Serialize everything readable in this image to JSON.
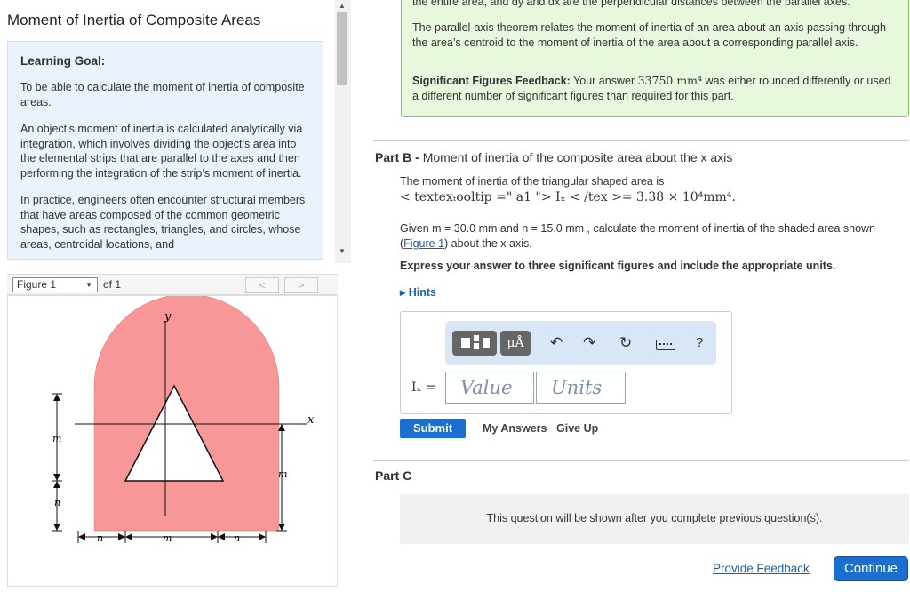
{
  "left": {
    "title": "Moment of Inertia of Composite Areas",
    "goal_heading": "Learning Goal:",
    "goal_p1": "To be able to calculate the moment of inertia of composite areas.",
    "goal_p2": "An object’s moment of inertia is calculated analytically via integration, which involves dividing the object’s area into the elemental strips that are parallel to the axes and then performing the integration of the strip’s moment of inertia.",
    "goal_p3": "In practice, engineers often encounter structural members that have areas composed of the common geometric shapes, such as rectangles, triangles, and circles, whose areas, centroidal locations, and"
  },
  "figure": {
    "select_value": "Figure 1",
    "of_label": "of 1",
    "prev_label": "<",
    "next_label": ">",
    "labels": {
      "y": "y",
      "x": "x",
      "m_left": "m",
      "n_left": "n",
      "m_right": "m",
      "n_bottom1": "n",
      "m_bottom": "m",
      "n_bottom2": "n"
    },
    "shape_color": "#f79797"
  },
  "feedback": {
    "cut_text": "the entire area, and dy and dx are the perpendicular distances between the parallel axes.",
    "theorem": "The parallel-axis theorem relates the moment of inertia of an area about an axis passing through the area’s centroid to the moment of inertia of the area about a corresponding parallel axis.",
    "sigfig_label": "Significant Figures Feedback:",
    "sigfig_pre": "Your answer",
    "sigfig_value": "33750 mm⁴",
    "sigfig_post": "was either rounded differently or used a different number of significant figures than required for this part."
  },
  "partB": {
    "label": "Part B -",
    "title": "Moment of inertia of the composite area about the x axis",
    "moment_line1": "The moment of inertia of the triangular shaped area is",
    "moment_line2": "< textexₜooltip =\" a1 \"> Iₓ < /tex >= 3.38 × 10⁴mm⁴.",
    "given_pre": "Given m = 30.0 mm and n = 15.0 mm , calculate the moment of inertia of the shaded area shown (",
    "given_link": "Figure 1",
    "given_post": ") about the x axis.",
    "express": "Express your answer to three significant figures and include the appropriate units.",
    "hints": "▸ Hints",
    "answer_label": "Iₓ =",
    "value_placeholder": "Value",
    "units_placeholder": "Units",
    "units_btn": "μÅ",
    "submit": "Submit",
    "my_answers": "My Answers",
    "give_up": "Give Up"
  },
  "partC": {
    "title": "Part C",
    "message": "This question will be shown after you complete previous question(s)."
  },
  "footer": {
    "provide_feedback": "Provide Feedback",
    "continue": "Continue"
  }
}
